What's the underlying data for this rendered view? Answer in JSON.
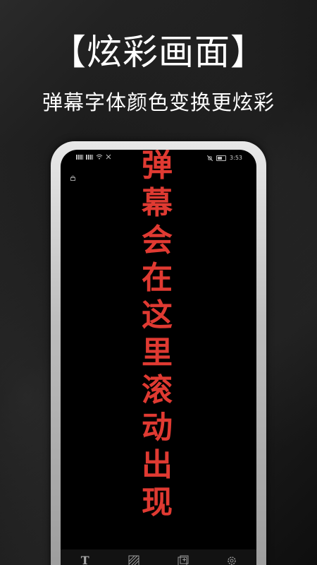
{
  "promo": {
    "headline": "【炫彩画面】",
    "subhead": "弹幕字体颜色变换更炫彩"
  },
  "status_bar": {
    "left_text": "",
    "time": "3:53"
  },
  "danmaku": {
    "text": "弹幕会在这里滚动出现",
    "chars": [
      "弹",
      "幕",
      "会",
      "在",
      "这",
      "里",
      "滚",
      "动",
      "出",
      "现"
    ],
    "color": "#e03a32"
  },
  "bottom_nav": {
    "items": [
      {
        "label": "文字",
        "icon": "text-icon"
      },
      {
        "label": "背景",
        "icon": "background-icon"
      },
      {
        "label": "模板",
        "icon": "template-icon"
      },
      {
        "label": "设置",
        "icon": "settings-icon"
      }
    ]
  }
}
